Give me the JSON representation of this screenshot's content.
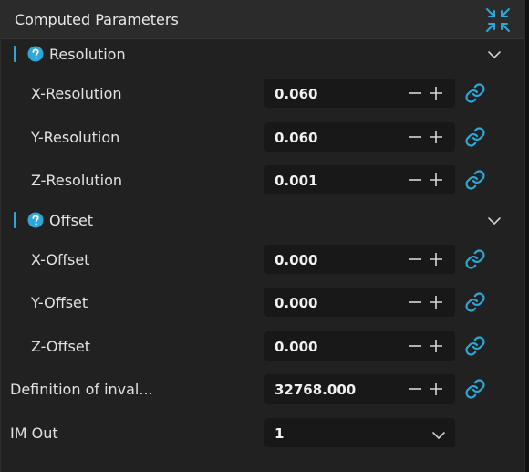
{
  "panel": {
    "title": "Computed Parameters",
    "collapse_icon": "collapse-arrows-icon"
  },
  "sections": {
    "resolution": {
      "label": "Resolution",
      "rows": [
        {
          "label": "X-Resolution",
          "value": "0.060"
        },
        {
          "label": "Y-Resolution",
          "value": "0.060"
        },
        {
          "label": "Z-Resolution",
          "value": "0.001"
        }
      ]
    },
    "offset": {
      "label": "Offset",
      "rows": [
        {
          "label": "X-Offset",
          "value": "0.000"
        },
        {
          "label": "Y-Offset",
          "value": "0.000"
        },
        {
          "label": "Z-Offset",
          "value": "0.000"
        }
      ]
    }
  },
  "definition_invalid": {
    "label": "Definition of inval...",
    "value": "32768.000"
  },
  "im_out": {
    "label": "IM Out",
    "value": "1"
  },
  "colors": {
    "accent": "#2ba7d8",
    "panel_bg": "#212121",
    "header_bg": "#2b2b2b",
    "field_bg": "#181818"
  }
}
